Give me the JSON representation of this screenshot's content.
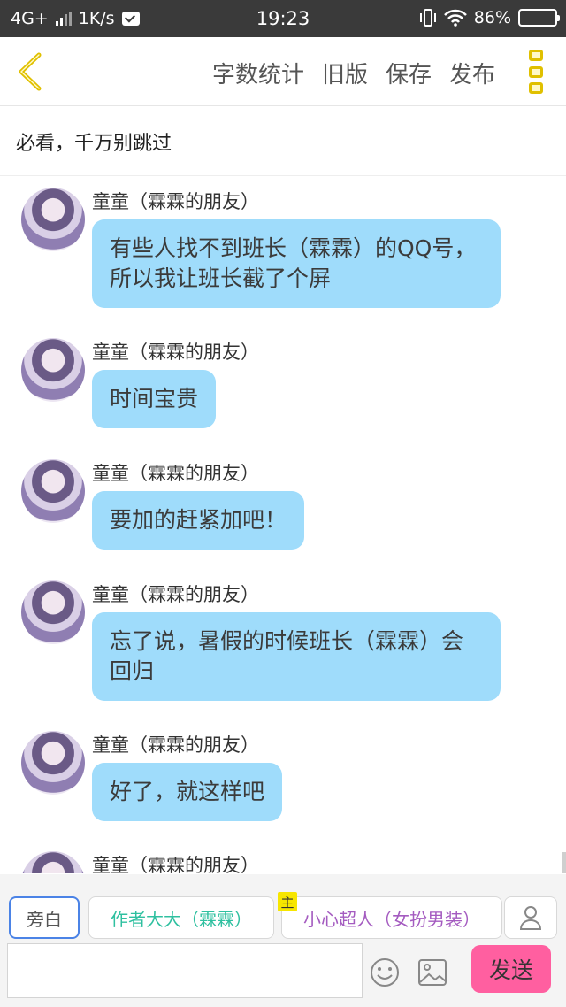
{
  "status_bar": {
    "network": "4G+",
    "speed": "1K/s",
    "time": "19:23",
    "battery": "86%",
    "battery_level": 0.86
  },
  "header": {
    "back_icon": "chevron-left-icon",
    "actions": [
      "字数统计",
      "旧版",
      "保存",
      "发布"
    ],
    "menu_icon": "more-vertical-icon",
    "accent_color": "#e0c000"
  },
  "title": "必看，千万别跳过",
  "messages": [
    {
      "sender": "童童（霖霖的朋友）",
      "text": "有些人找不到班长（霖霖）的QQ号，所以我让班长截了个屏"
    },
    {
      "sender": "童童（霖霖的朋友）",
      "text": "时间宝贵"
    },
    {
      "sender": "童童（霖霖的朋友）",
      "text": "要加的赶紧加吧！"
    },
    {
      "sender": "童童（霖霖的朋友）",
      "text": "忘了说，暑假的时候班长（霖霖）会回归"
    },
    {
      "sender": "童童（霖霖的朋友）",
      "text": "好了，就这样吧"
    },
    {
      "sender": "童童（霖霖的朋友）",
      "text": ""
    }
  ],
  "bubble_color": "#9fdcfb",
  "bottom": {
    "roles": {
      "narration": "旁白",
      "author": "作者大大（霖霖）",
      "heroine": "小心超人（女扮男装）"
    },
    "main_tag": "主",
    "input_value": "",
    "input_placeholder": "",
    "send_label": "发送",
    "send_color": "#ff5fa0"
  }
}
